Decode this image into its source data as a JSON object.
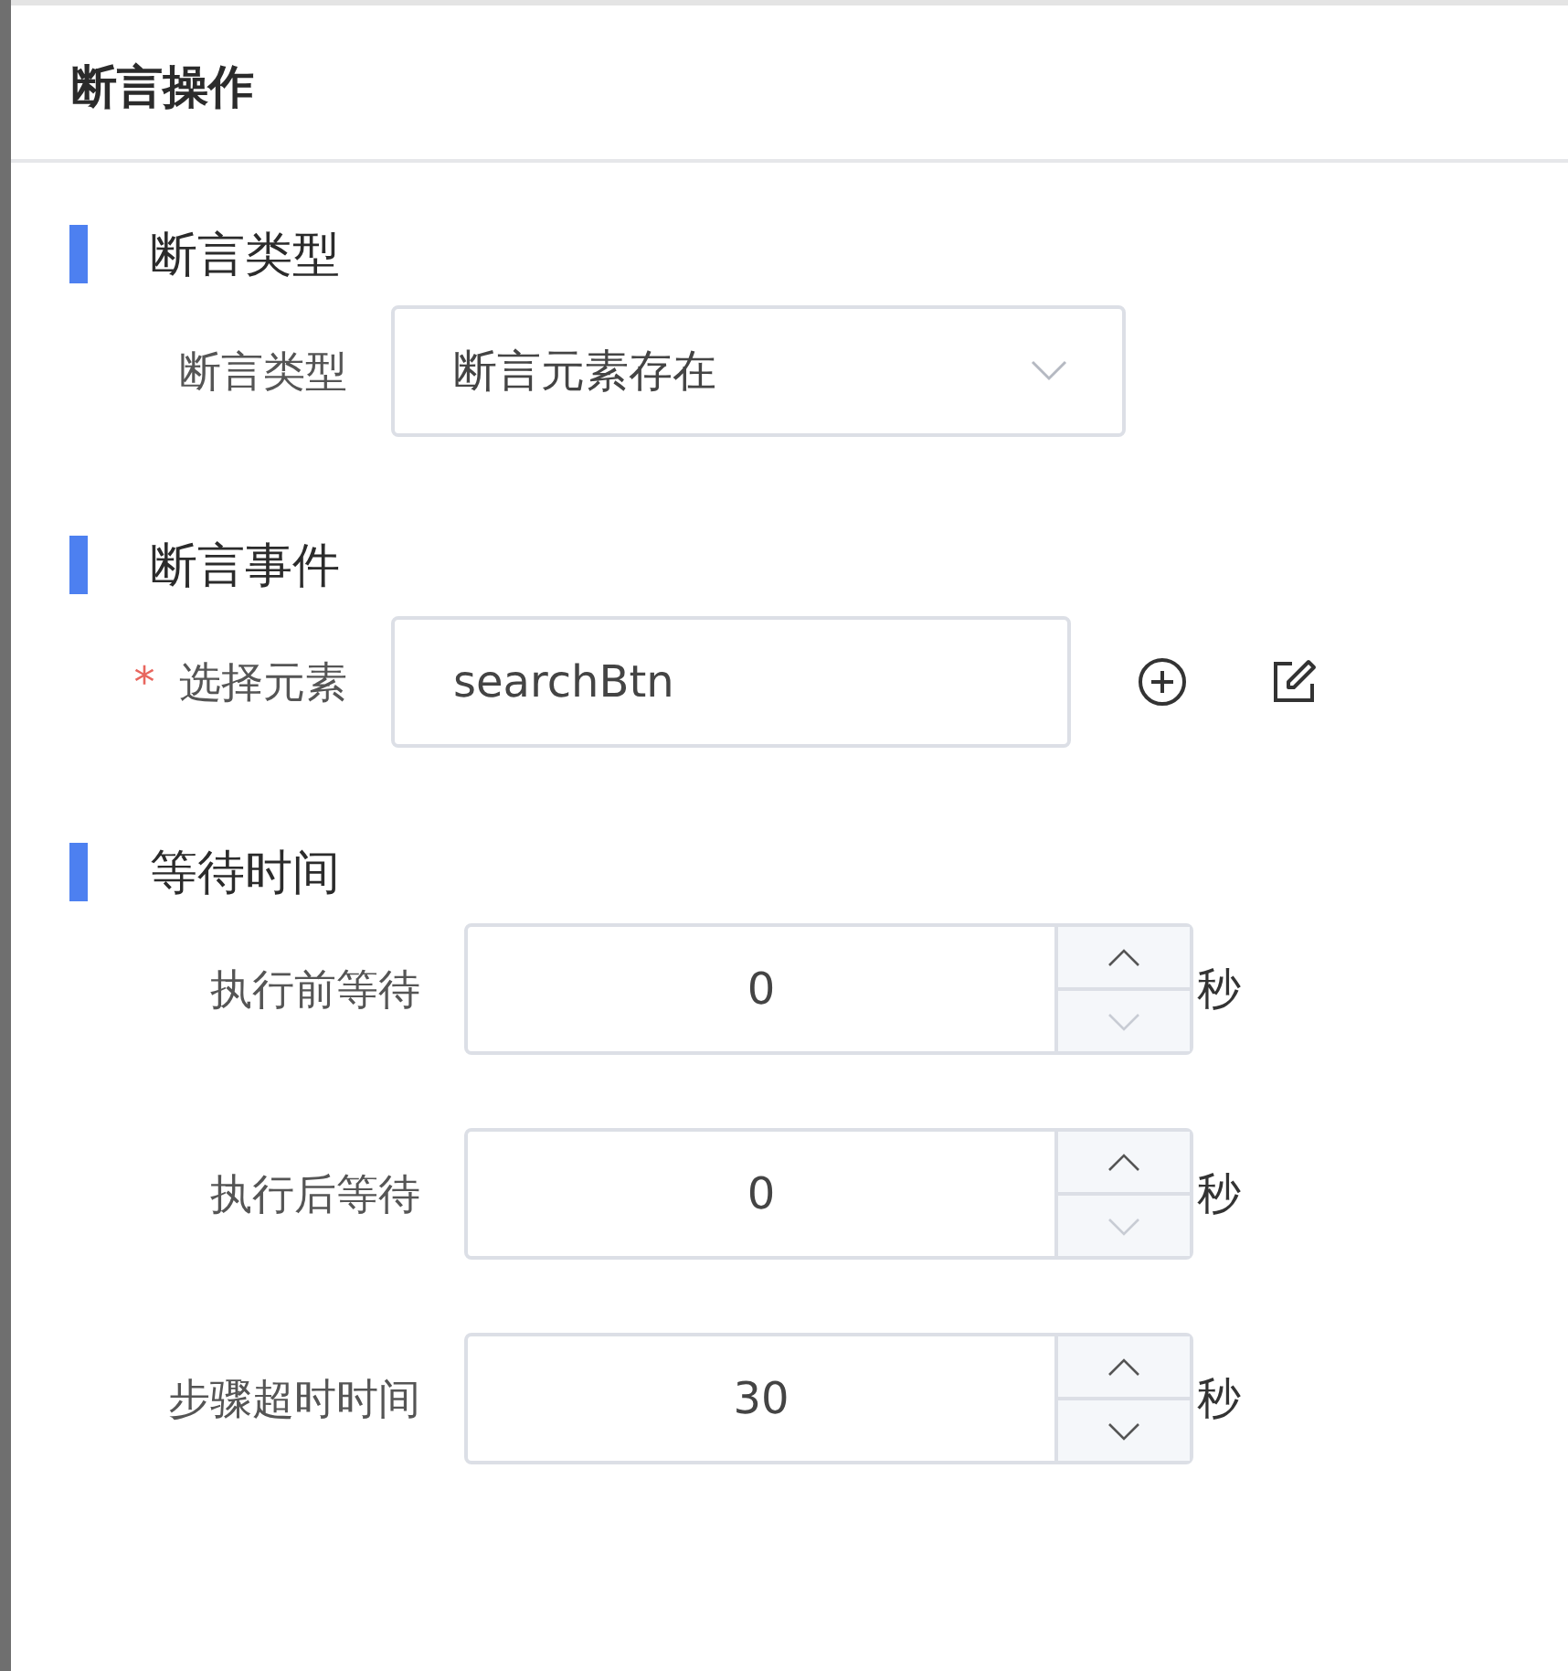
{
  "drawer": {
    "title": "断言操作"
  },
  "sections": [
    {
      "heading": "断言类型",
      "fields": [
        {
          "kind": "select",
          "label": "断言类型",
          "value": "断言元素存在"
        }
      ]
    },
    {
      "heading": "断言事件",
      "fields": [
        {
          "kind": "text",
          "label": "选择元素",
          "required_mark": "*",
          "value": "searchBtn"
        }
      ]
    },
    {
      "heading": "等待时间",
      "fields": [
        {
          "kind": "number",
          "label": "执行前等待",
          "value": "0",
          "unit": "秒",
          "decrement_disabled": true
        },
        {
          "kind": "number",
          "label": "执行后等待",
          "value": "0",
          "unit": "秒",
          "decrement_disabled": true
        },
        {
          "kind": "number",
          "label": "步骤超时时间",
          "value": "30",
          "unit": "秒",
          "decrement_disabled": false
        }
      ]
    }
  ]
}
